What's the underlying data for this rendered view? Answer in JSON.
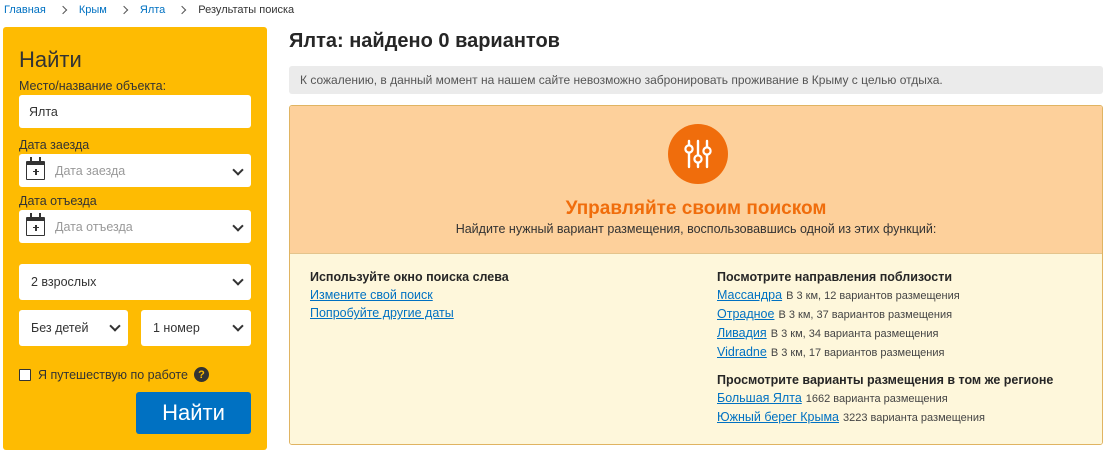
{
  "breadcrumb": {
    "items": [
      "Главная",
      "Крым",
      "Ялта"
    ],
    "current": "Результаты поиска"
  },
  "sidebar": {
    "title": "Найти",
    "destination_label": "Место/название объекта:",
    "destination_value": "Ялта",
    "checkin_label": "Дата заезда",
    "checkin_placeholder": "Дата заезда",
    "checkout_label": "Дата отъезда",
    "checkout_placeholder": "Дата отъезда",
    "adults_value": "2 взрослых",
    "children_value": "Без детей",
    "rooms_value": "1 номер",
    "work_travel_label": "Я путешествую по работе",
    "help_glyph": "?",
    "search_button": "Найти"
  },
  "main": {
    "heading": "Ялта: найдено 0 вариантов",
    "notice": "К сожалению, в данный момент на нашем сайте невозможно забронировать проживание в Крыму с целью отдыха.",
    "panel": {
      "icon": "sliders-icon",
      "title": "Управляйте своим поиском",
      "subtitle": "Найдите нужный вариант размещения, воспользовавшись одной из этих функций:",
      "left_heading": "Используйте окно поиска слева",
      "left_links": [
        "Измените свой поиск",
        "Попробуйте другие даты"
      ],
      "nearby_heading": "Посмотрите направления поблизости",
      "nearby": [
        {
          "name": "Массандра",
          "meta": "В 3 км, 12 вариантов размещения"
        },
        {
          "name": "Отрадное",
          "meta": "В 3 км, 37 вариантов размещения"
        },
        {
          "name": "Ливадия",
          "meta": "В 3 км, 34 варианта размещения"
        },
        {
          "name": "Vidradne",
          "meta": "В 3 км, 17 вариантов размещения"
        }
      ],
      "region_heading": "Просмотрите варианты размещения в том же регионе",
      "region": [
        {
          "name": "Большая Ялта",
          "meta": "1662 варианта размещения"
        },
        {
          "name": "Южный берег Крыма",
          "meta": "3223 варианта размещения"
        }
      ]
    }
  },
  "colors": {
    "brand_yellow": "#febb02",
    "link_blue": "#0071c2",
    "accent_orange": "#f06d0c",
    "panel_peach": "#fdd09b",
    "panel_cream": "#fef7db"
  }
}
